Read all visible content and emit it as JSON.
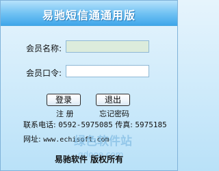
{
  "window": {
    "title": "易驰短信通通用版"
  },
  "form": {
    "member_name_label": "会员名称:",
    "member_name_value": "",
    "member_password_label": "会员口令:",
    "member_password_value": ""
  },
  "buttons": {
    "login": "登录",
    "exit": "退出"
  },
  "links": {
    "register": "注 册",
    "forgot_password": "忘记密码"
  },
  "contact": {
    "phone_label": "联系电话:",
    "phone_value": "0592-5975085",
    "fax_label": "传真:",
    "fax_value": "5975185",
    "website_label": "网址:",
    "website_value": "www.echisoft.com"
  },
  "watermark": {
    "brand": "绿色软件站",
    "domain": "gdooo.com"
  },
  "footer": {
    "text": "易驰软件  版权所有"
  },
  "colors": {
    "title_bar_top": "#b7e2fb",
    "title_bar_bottom": "#3fa6ea",
    "background": "#d2ecfb",
    "name_input_fill": "#dcecdc",
    "password_input_fill": "#ffffff"
  }
}
